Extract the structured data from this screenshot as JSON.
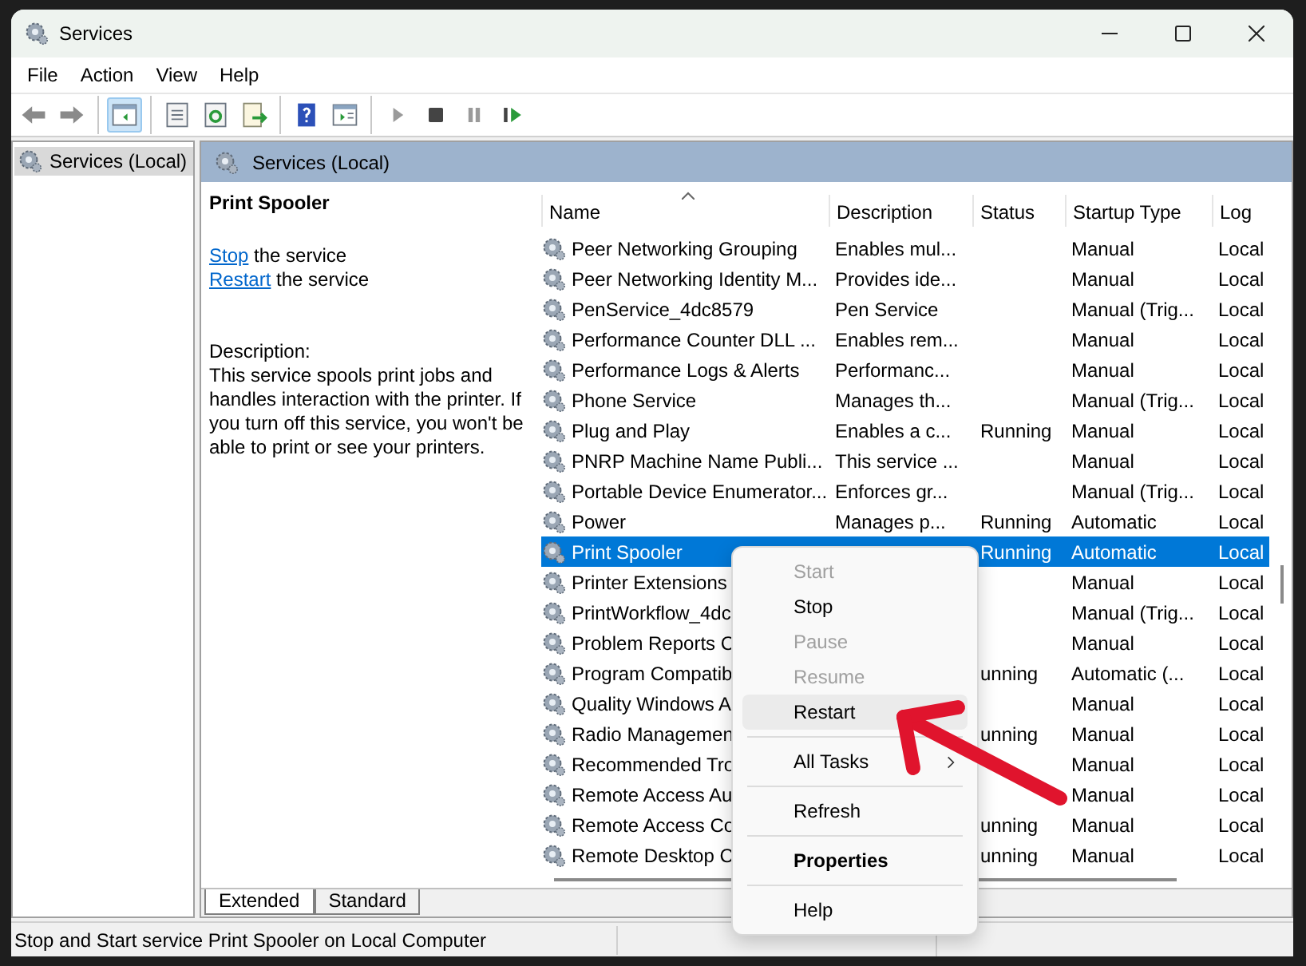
{
  "window": {
    "title": "Services"
  },
  "menu_bar": [
    "File",
    "Action",
    "View",
    "Help"
  ],
  "toolbar": [
    {
      "kind": "back",
      "selected": false
    },
    {
      "kind": "forward",
      "selected": false
    },
    {
      "kind": "separator"
    },
    {
      "kind": "tree",
      "selected": true
    },
    {
      "kind": "separator"
    },
    {
      "kind": "properties",
      "selected": false
    },
    {
      "kind": "refresh",
      "selected": false
    },
    {
      "kind": "export",
      "selected": false
    },
    {
      "kind": "separator"
    },
    {
      "kind": "help",
      "selected": false
    },
    {
      "kind": "action_pane",
      "selected": false
    },
    {
      "kind": "separator"
    },
    {
      "kind": "play",
      "selected": false
    },
    {
      "kind": "stop",
      "selected": false
    },
    {
      "kind": "pause",
      "selected": false
    },
    {
      "kind": "resume",
      "selected": false
    }
  ],
  "tree": [
    {
      "label": "Services (Local)",
      "selected": true
    }
  ],
  "pane_header": "Services (Local)",
  "details": {
    "title": "Print Spooler",
    "actions": [
      {
        "link": "Stop",
        "text": " the service"
      },
      {
        "link": "Restart",
        "text": " the service"
      }
    ],
    "description_label": "Description:",
    "description": "This service spools print jobs and handles interaction with the printer. If you turn off this service, you won't be able to print or see your printers."
  },
  "table": {
    "columns": [
      "Name",
      "Description",
      "Status",
      "Startup Type",
      "Log"
    ],
    "rows": [
      {
        "name": "Peer Networking Grouping",
        "description": "Enables mul...",
        "status": "",
        "startup": "Manual",
        "log": "Local",
        "selected": false
      },
      {
        "name": "Peer Networking Identity M...",
        "description": "Provides ide...",
        "status": "",
        "startup": "Manual",
        "log": "Local",
        "selected": false
      },
      {
        "name": "PenService_4dc8579",
        "description": "Pen Service",
        "status": "",
        "startup": "Manual (Trig...",
        "log": "Local",
        "selected": false
      },
      {
        "name": "Performance Counter DLL ...",
        "description": "Enables rem...",
        "status": "",
        "startup": "Manual",
        "log": "Local",
        "selected": false
      },
      {
        "name": "Performance Logs & Alerts",
        "description": "Performanc...",
        "status": "",
        "startup": "Manual",
        "log": "Local",
        "selected": false
      },
      {
        "name": "Phone Service",
        "description": "Manages th...",
        "status": "",
        "startup": "Manual (Trig...",
        "log": "Local",
        "selected": false
      },
      {
        "name": "Plug and Play",
        "description": "Enables a c...",
        "status": "Running",
        "startup": "Manual",
        "log": "Local",
        "selected": false
      },
      {
        "name": "PNRP Machine Name Publi...",
        "description": "This service ...",
        "status": "",
        "startup": "Manual",
        "log": "Local",
        "selected": false
      },
      {
        "name": "Portable Device Enumerator...",
        "description": "Enforces gr...",
        "status": "",
        "startup": "Manual (Trig...",
        "log": "Local",
        "selected": false
      },
      {
        "name": "Power",
        "description": "Manages p...",
        "status": "Running",
        "startup": "Automatic",
        "log": "Local",
        "selected": false
      },
      {
        "name": "Print Spooler",
        "description": "",
        "status": "Running",
        "startup": "Automatic",
        "log": "Local",
        "selected": true
      },
      {
        "name": "Printer Extensions",
        "description": "",
        "status": "",
        "startup": "Manual",
        "log": "Local",
        "selected": false
      },
      {
        "name": "PrintWorkflow_4dc",
        "description": "",
        "status": "",
        "startup": "Manual (Trig...",
        "log": "Local",
        "selected": false
      },
      {
        "name": "Problem Reports C",
        "description": "",
        "status": "",
        "startup": "Manual",
        "log": "Local",
        "selected": false
      },
      {
        "name": "Program Compatib",
        "description": "",
        "status": "unning",
        "startup": "Automatic (...",
        "log": "Local",
        "selected": false
      },
      {
        "name": "Quality Windows A",
        "description": "",
        "status": "",
        "startup": "Manual",
        "log": "Local",
        "selected": false
      },
      {
        "name": "Radio Managemen",
        "description": "",
        "status": "unning",
        "startup": "Manual",
        "log": "Local",
        "selected": false
      },
      {
        "name": "Recommended Tro",
        "description": "",
        "status": "",
        "startup": "Manual",
        "log": "Local",
        "selected": false
      },
      {
        "name": "Remote Access Au",
        "description": "",
        "status": "",
        "startup": "Manual",
        "log": "Local",
        "selected": false
      },
      {
        "name": "Remote Access Co",
        "description": "",
        "status": "unning",
        "startup": "Manual",
        "log": "Local",
        "selected": false
      },
      {
        "name": "Remote Desktop C",
        "description": "",
        "status": "unning",
        "startup": "Manual",
        "log": "Local",
        "selected": false
      }
    ]
  },
  "view_tabs": [
    {
      "label": "Extended",
      "selected": true
    },
    {
      "label": "Standard",
      "selected": false
    }
  ],
  "context_menu": [
    {
      "kind": "item",
      "label": "Start",
      "disabled": true,
      "selected": false
    },
    {
      "kind": "item",
      "label": "Stop",
      "disabled": false,
      "selected": false
    },
    {
      "kind": "item",
      "label": "Pause",
      "disabled": true,
      "selected": false
    },
    {
      "kind": "item",
      "label": "Resume",
      "disabled": true,
      "selected": false
    },
    {
      "kind": "item",
      "label": "Restart",
      "disabled": false,
      "selected": true
    },
    {
      "kind": "separator"
    },
    {
      "kind": "submenu",
      "label": "All Tasks",
      "disabled": false,
      "selected": false
    },
    {
      "kind": "separator"
    },
    {
      "kind": "item",
      "label": "Refresh",
      "disabled": false,
      "selected": false
    },
    {
      "kind": "separator"
    },
    {
      "kind": "default",
      "label": "Properties",
      "disabled": false,
      "selected": false
    },
    {
      "kind": "separator"
    },
    {
      "kind": "item",
      "label": "Help",
      "disabled": false,
      "selected": false
    }
  ],
  "status_bar": "Stop and Start service Print Spooler on Local Computer"
}
